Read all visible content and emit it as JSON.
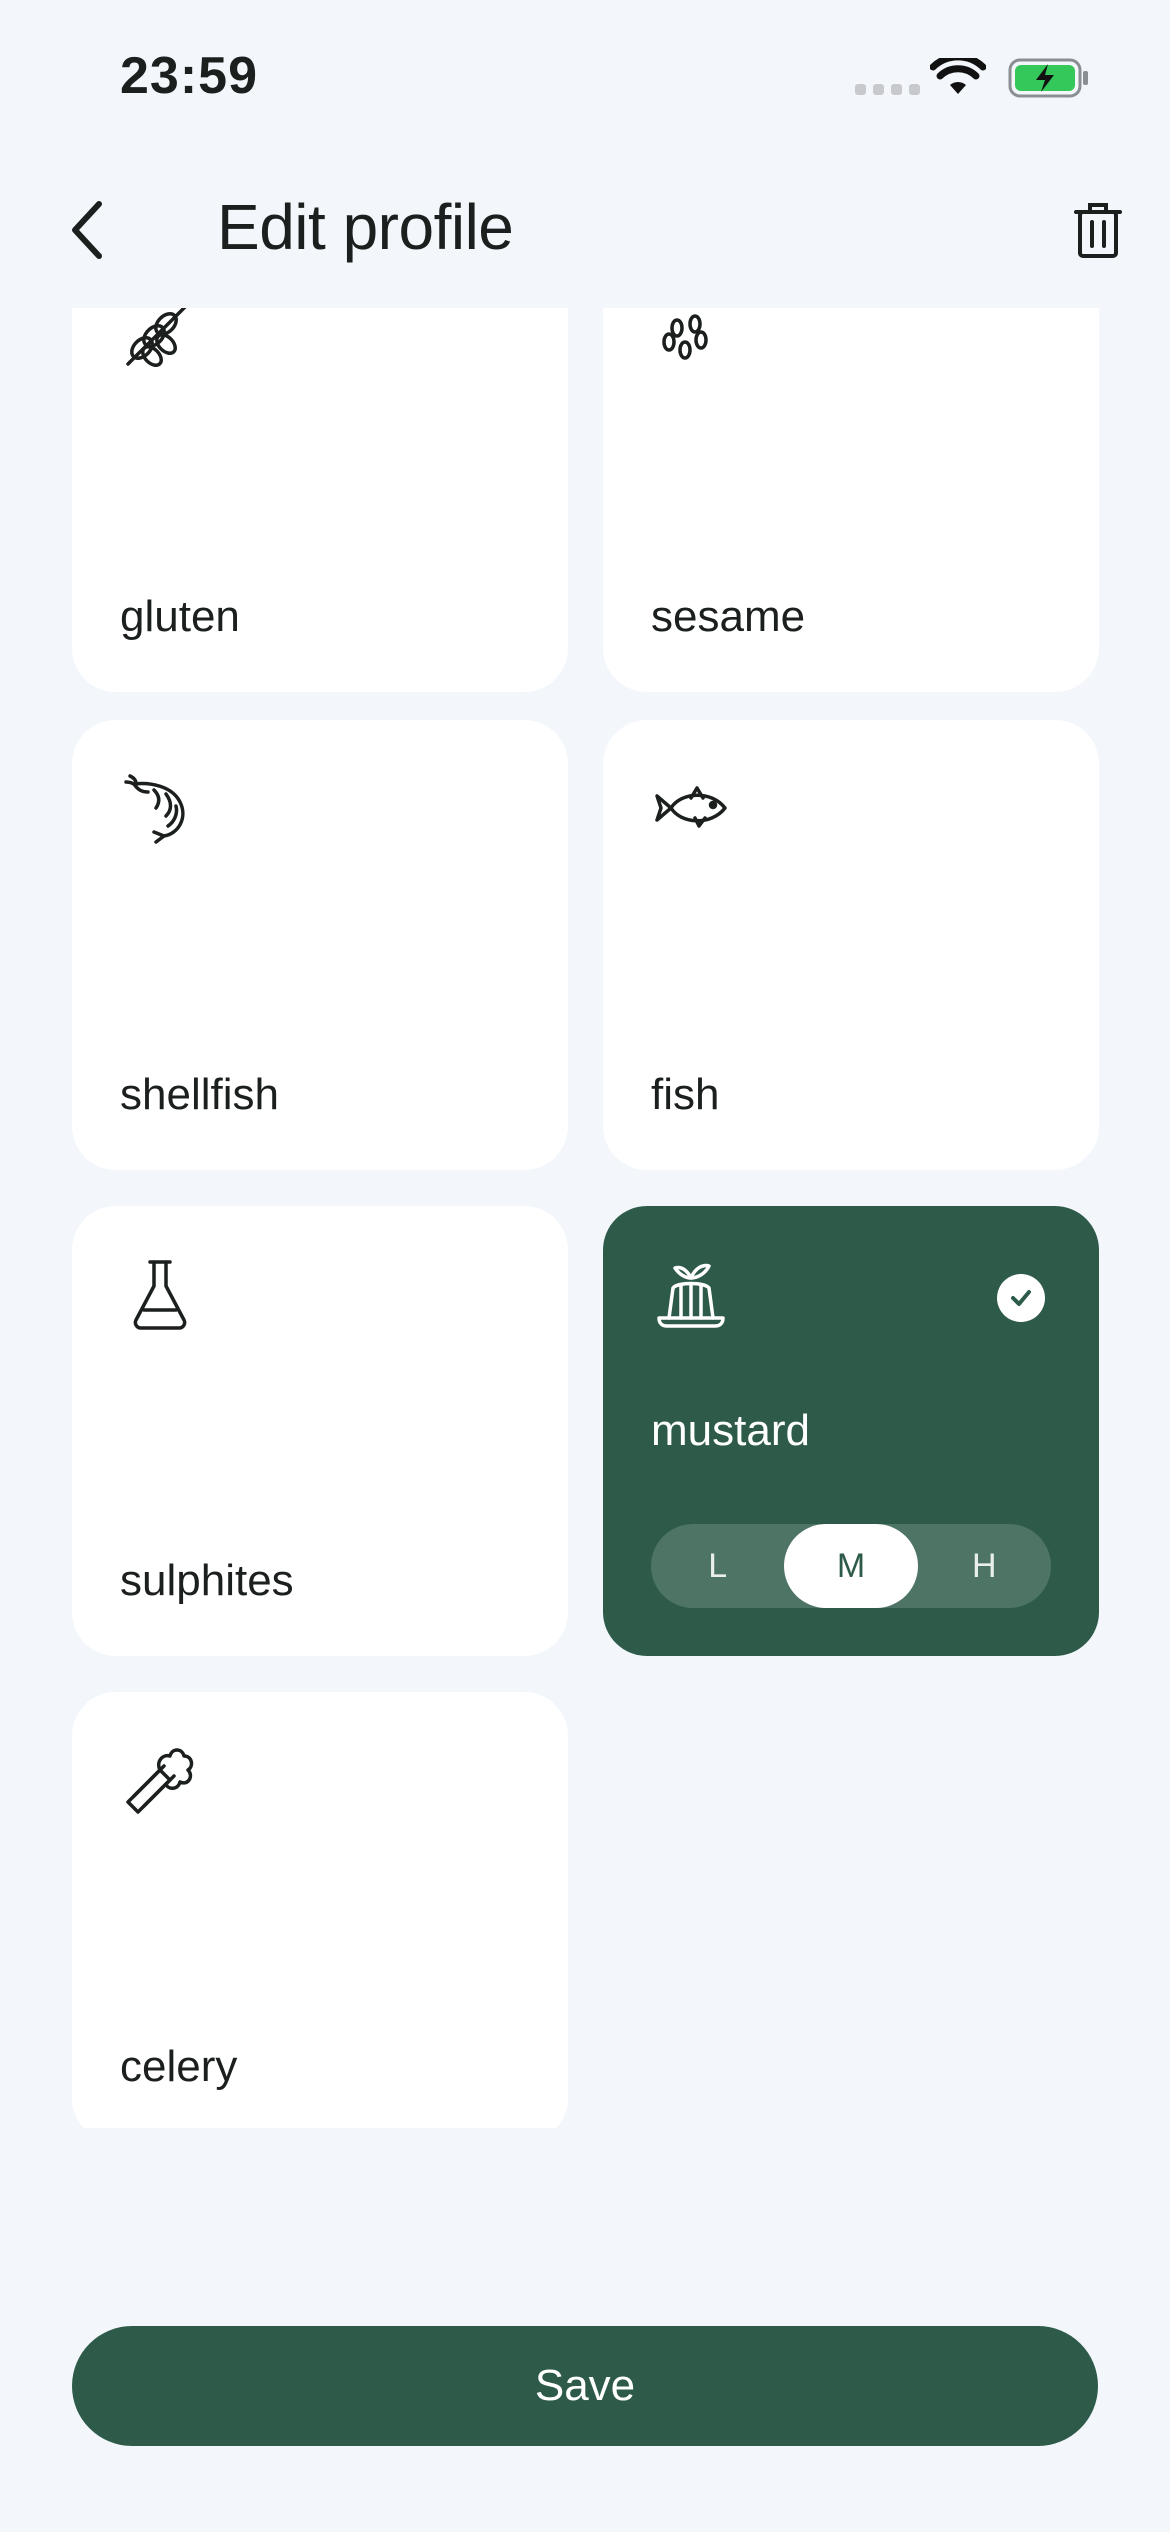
{
  "status_bar": {
    "time": "23:59"
  },
  "header": {
    "title": "Edit profile"
  },
  "allergens": [
    {
      "label": "gluten",
      "icon": "wheat-icon",
      "selected": false
    },
    {
      "label": "sesame",
      "icon": "sesame-seeds-icon",
      "selected": false
    },
    {
      "label": "shellfish",
      "icon": "shrimp-icon",
      "selected": false
    },
    {
      "label": "fish",
      "icon": "fish-icon",
      "selected": false
    },
    {
      "label": "sulphites",
      "icon": "flask-icon",
      "selected": false
    },
    {
      "label": "mustard",
      "icon": "jelly-mold-icon",
      "selected": true,
      "severity_options": [
        "L",
        "M",
        "H"
      ],
      "severity": "M"
    },
    {
      "label": "celery",
      "icon": "celery-icon",
      "selected": false
    }
  ],
  "save_label": "Save",
  "colors": {
    "background": "#f3f7fc",
    "accent": "#2e5b49",
    "card": "#ffffff"
  }
}
